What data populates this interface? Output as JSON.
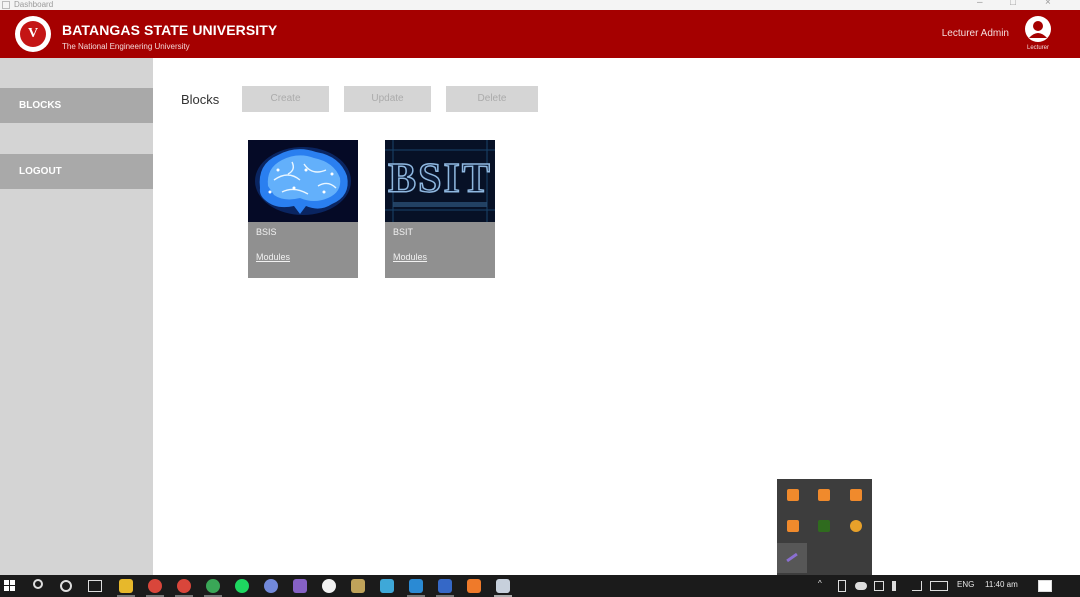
{
  "window": {
    "title": "Dashboard"
  },
  "header": {
    "university_name": "BATANGAS STATE UNIVERSITY",
    "tagline": "The National Engineering University",
    "user_name": "Lecturer Admin",
    "avatar_label": "Lecturer",
    "brand_color": "#a50000"
  },
  "sidebar": {
    "items": [
      {
        "label": "BLOCKS"
      },
      {
        "label": "LOGOUT"
      }
    ]
  },
  "main": {
    "title": "Blocks",
    "toolbar": {
      "create_label": "Create",
      "update_label": "Update",
      "delete_label": "Delete"
    },
    "cards": [
      {
        "name": "BSIS",
        "link_label": "Modules",
        "image": "brain-circuit"
      },
      {
        "name": "BSIT",
        "link_label": "Modules",
        "image": "bsit-text"
      }
    ],
    "bsit_image_text": "BSIT"
  },
  "taskbar": {
    "language": "ENG",
    "time": "11:40 am"
  }
}
